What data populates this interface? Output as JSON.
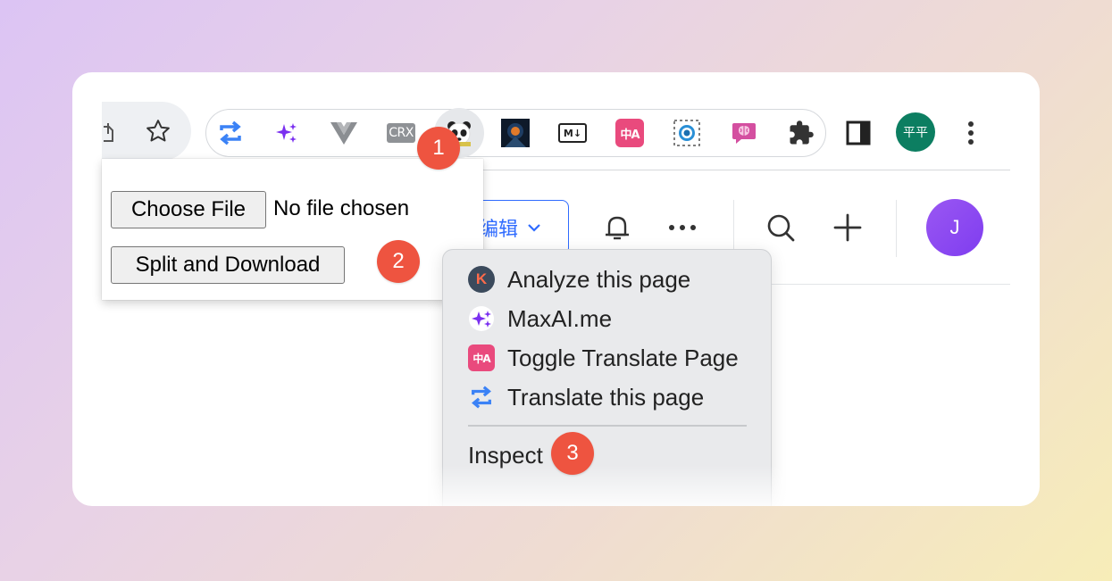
{
  "toolbar": {
    "extensions": [
      {
        "name": "translate-loop"
      },
      {
        "name": "maxai-sparkle"
      },
      {
        "name": "vue-devtools"
      },
      {
        "name": "crx",
        "label": "CRX"
      },
      {
        "name": "panda"
      },
      {
        "name": "dark-art"
      },
      {
        "name": "markdown",
        "label": "M↓"
      },
      {
        "name": "translate-page",
        "label": "中A"
      },
      {
        "name": "screen-capture"
      },
      {
        "name": "brain"
      },
      {
        "name": "puzzle"
      }
    ],
    "profile_label": "平平"
  },
  "page": {
    "edit_label": "编辑",
    "avatar_initial": "J"
  },
  "popup": {
    "choose_file_label": "Choose File",
    "no_file_label": "No file chosen",
    "split_download_label": "Split and Download"
  },
  "context_menu": {
    "items": [
      {
        "label": "Analyze this page",
        "icon": "k-icon"
      },
      {
        "label": "MaxAI.me",
        "icon": "maxai-icon"
      },
      {
        "label": "Toggle Translate Page",
        "icon": "translate-page-icon"
      },
      {
        "label": "Translate this page",
        "icon": "translate-loop-icon"
      }
    ],
    "inspect_label": "Inspect"
  },
  "badges": [
    "1",
    "2",
    "3"
  ],
  "colors": {
    "accent_blue": "#2f6bff",
    "badge_red": "#ee5440",
    "profile_green": "#0c7e61",
    "avatar_purple": "#8a47f1"
  }
}
